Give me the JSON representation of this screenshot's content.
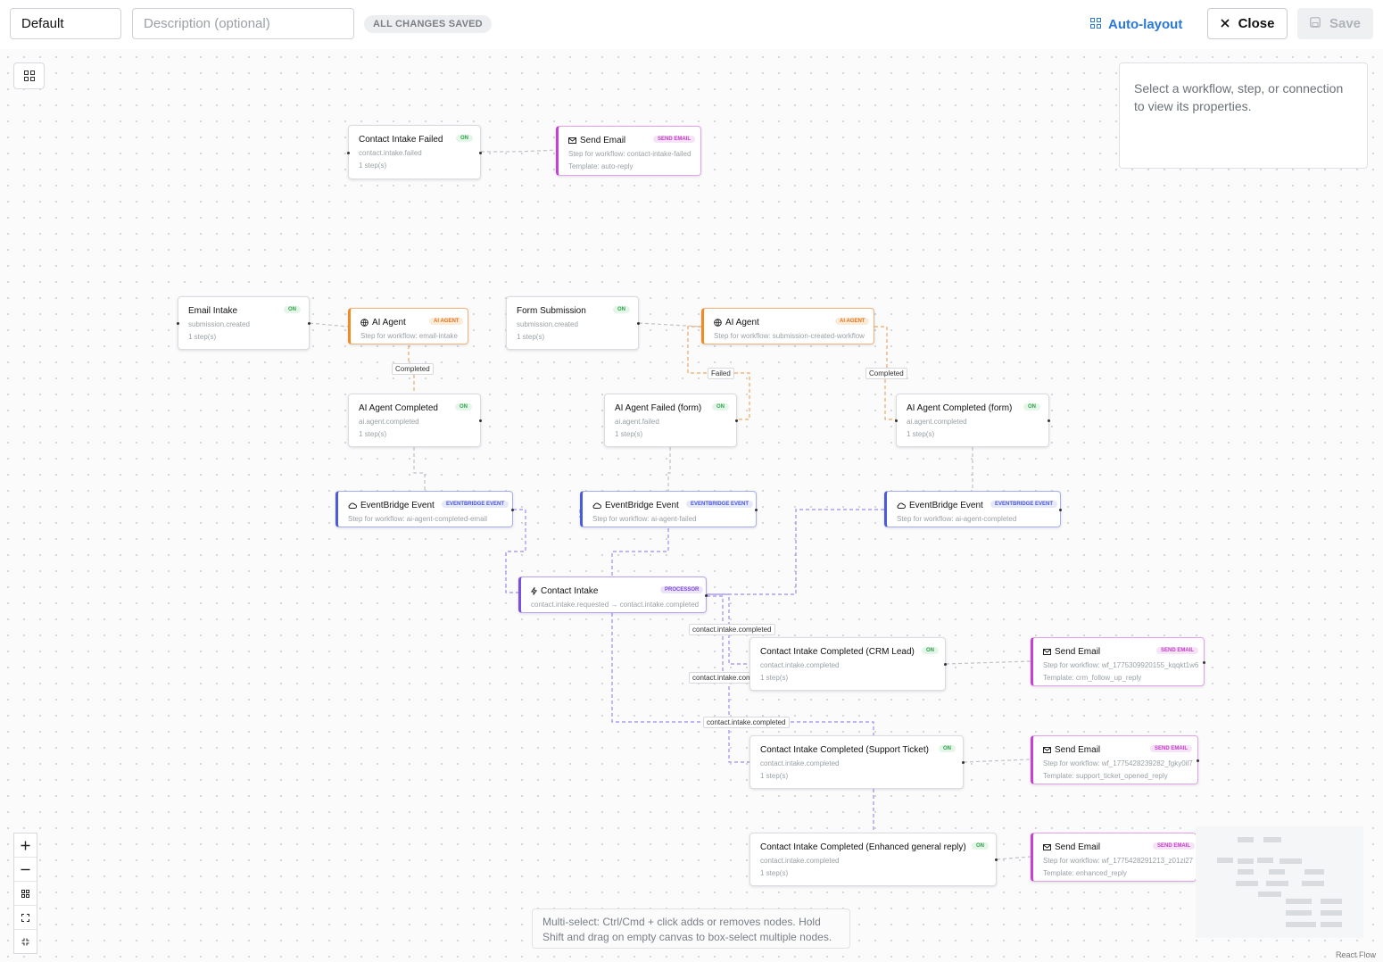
{
  "header": {
    "name_value": "Default",
    "description_placeholder": "Description (optional)",
    "saved_badge": "ALL CHANGES SAVED",
    "auto_layout_label": "Auto-layout",
    "close_label": "Close",
    "save_label": "Save"
  },
  "properties_panel": {
    "empty_text": "Select a workflow, step, or connection to view its properties."
  },
  "nodes": {
    "n1": {
      "title": "Contact Intake Failed",
      "tag": "ON",
      "sub": "contact.intake.failed",
      "sub2": "1 step(s)"
    },
    "n2": {
      "title": "Send Email",
      "tag": "SEND EMAIL",
      "sub": "Step for workflow: contact-intake-failed",
      "sub2": "Template: auto-reply"
    },
    "n3": {
      "title": "Email Intake",
      "tag": "ON",
      "sub": "submission.created",
      "sub2": "1 step(s)"
    },
    "n4": {
      "title": "AI Agent",
      "tag": "AI AGENT",
      "sub": "Step for workflow: email-intake"
    },
    "n5": {
      "title": "Form Submission",
      "tag": "ON",
      "sub": "submission.created",
      "sub2": "1 step(s)"
    },
    "n6": {
      "title": "AI Agent",
      "tag": "AI AGENT",
      "sub": "Step for workflow: submission-created-workflow"
    },
    "n7": {
      "title": "AI Agent Completed",
      "tag": "ON",
      "sub": "ai.agent.completed",
      "sub2": "1 step(s)"
    },
    "n8": {
      "title": "AI Agent Failed (form)",
      "tag": "ON",
      "sub": "ai.agent.failed",
      "sub2": "1 step(s)"
    },
    "n9": {
      "title": "AI Agent Completed (form)",
      "tag": "ON",
      "sub": "ai.agent.completed",
      "sub2": "1 step(s)"
    },
    "n10": {
      "title": "EventBridge Event",
      "tag": "EVENTBRIDGE EVENT",
      "sub": "Step for workflow: ai-agent-completed-email"
    },
    "n11": {
      "title": "EventBridge Event",
      "tag": "EVENTBRIDGE EVENT",
      "sub": "Step for workflow: ai-agent-failed"
    },
    "n12": {
      "title": "EventBridge Event",
      "tag": "EVENTBRIDGE EVENT",
      "sub": "Step for workflow: ai-agent-completed"
    },
    "n13": {
      "title": "Contact Intake",
      "tag": "PROCESSOR",
      "sub": "contact.intake.requested → contact.intake.completed"
    },
    "n14": {
      "title": "Contact Intake Completed (CRM Lead)",
      "tag": "ON",
      "sub": "contact.intake.completed",
      "sub2": "1 step(s)"
    },
    "n15": {
      "title": "Send Email",
      "tag": "SEND EMAIL",
      "sub": "Step for workflow: wf_1775309920155_kqqkt1w6",
      "sub2": "Template: crm_follow_up_reply"
    },
    "n16": {
      "title": "Contact Intake Completed (Support Ticket)",
      "tag": "ON",
      "sub": "contact.intake.completed",
      "sub2": "1 step(s)"
    },
    "n17": {
      "title": "Send Email",
      "tag": "SEND EMAIL",
      "sub": "Step for workflow: wf_1775428239282_fgky0il7",
      "sub2": "Template: support_ticket_opened_reply"
    },
    "n18": {
      "title": "Contact Intake Completed (Enhanced general reply)",
      "tag": "ON",
      "sub": "contact.intake.completed",
      "sub2": "1 step(s)"
    },
    "n19": {
      "title": "Send Email",
      "tag": "SEND EMAIL",
      "sub": "Step for workflow: wf_1775428291213_z01zi27",
      "sub2": "Template: enhanced_reply"
    }
  },
  "edge_labels": {
    "e1": "Completed",
    "e2": "Failed",
    "e3": "Completed",
    "e4": "contact.intake.completed",
    "e5": "contact.intake.comp",
    "e6": "contact.intake.completed"
  },
  "hint_text": "Multi-select: Ctrl/Cmd + click adds or removes nodes. Hold Shift and drag on empty canvas to box-select multiple nodes.",
  "attribution": "React Flow",
  "colors": {
    "accent": "#2b78d6",
    "ai_agent": "#f08a24",
    "send_email": "#c540d4",
    "eventbridge": "#4b5bdc",
    "processor": "#7b4fe0",
    "on": "#2fa24b"
  }
}
